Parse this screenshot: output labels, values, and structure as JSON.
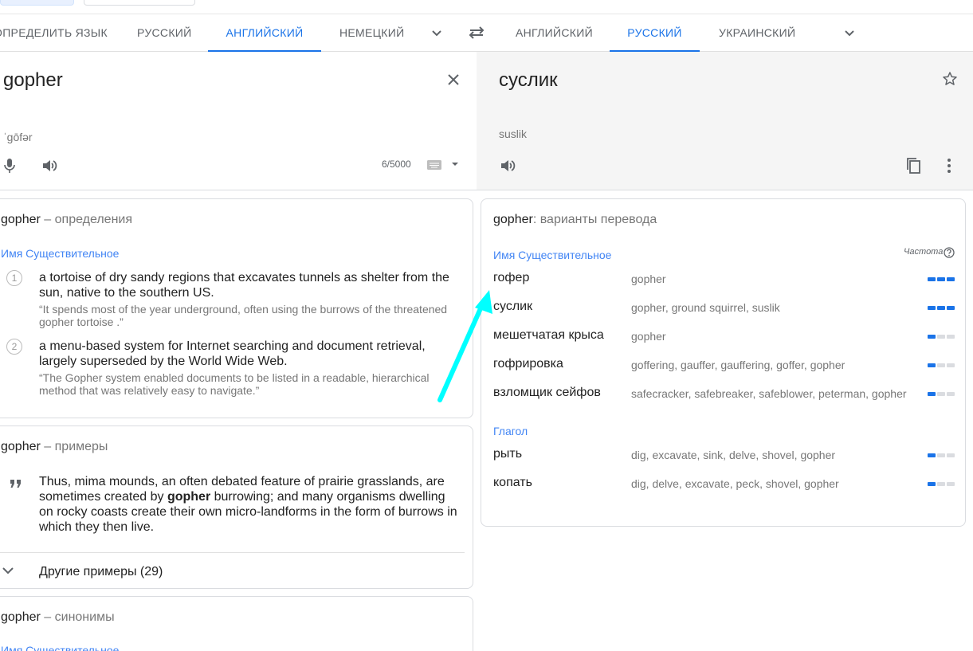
{
  "source_langs": [
    "ОПРЕДЕЛИТЬ ЯЗЫК",
    "РУССКИЙ",
    "АНГЛИЙСКИЙ",
    "НЕМЕЦКИЙ"
  ],
  "target_langs": [
    "АНГЛИЙСКИЙ",
    "РУССКИЙ",
    "УКРАИНСКИЙ"
  ],
  "source": {
    "text": "gopher",
    "transcription": "ˈɡōfər",
    "char_count": "6/5000"
  },
  "target": {
    "text": "суслик",
    "transliteration": "suslik"
  },
  "definitions": {
    "word": "gopher",
    "title_suffix": "– определения",
    "pos": "Имя Существительное",
    "items": [
      {
        "num": "1",
        "text": "a tortoise of dry sandy regions that excavates tunnels as shelter from the sun, native to the southern US.",
        "example": "“It spends most of the year underground, often using the burrows of the threatened gopher tortoise .”"
      },
      {
        "num": "2",
        "text": "a menu-based system for Internet searching and document retrieval, largely superseded by the World Wide Web.",
        "example": "“The Gopher system enabled documents to be listed in a readable, hierarchical method that was relatively easy to navigate.”"
      }
    ]
  },
  "examples": {
    "word": "gopher",
    "title_suffix": "– примеры",
    "text_before": "Thus, mima mounds, an often debated feature of prairie grasslands, are sometimes created by ",
    "text_bold": "gopher",
    "text_after": " burrowing; and many organisms dwelling on rocky coasts create their own micro-landforms in the form of burrows in which they then live.",
    "more_label": "Другие примеры (29)"
  },
  "synonyms": {
    "word": "gopher",
    "title_suffix": "– синонимы",
    "pos": "Имя Существительное"
  },
  "translations": {
    "word": "gopher",
    "title_suffix": ": варианты перевода",
    "frequency_label": "Частота",
    "groups": [
      {
        "pos": "Имя Существительное",
        "rows": [
          {
            "word": "гофер",
            "synonyms": "gopher",
            "freq": 3
          },
          {
            "word": "суслик",
            "synonyms": "gopher, ground squirrel, suslik",
            "freq": 3
          },
          {
            "word": "мешетчатая крыса",
            "synonyms": "gopher",
            "freq": 1
          },
          {
            "word": "гофрировка",
            "synonyms": "goffering, gauffer, gauffering, goffer, gopher",
            "freq": 1
          },
          {
            "word": "взломщик сейфов",
            "synonyms": "safecracker, safebreaker, safeblower, peterman, gopher",
            "freq": 1
          }
        ]
      },
      {
        "pos": "Глагол",
        "rows": [
          {
            "word": "рыть",
            "synonyms": "dig, excavate, sink, delve, shovel, gopher",
            "freq": 1
          },
          {
            "word": "копать",
            "synonyms": "dig, delve, excavate, peck, shovel, gopher",
            "freq": 1
          }
        ]
      }
    ]
  },
  "colors": {
    "accent": "#1a73e8",
    "pos_blue": "#4285f4",
    "arrow": "#00ffff"
  }
}
